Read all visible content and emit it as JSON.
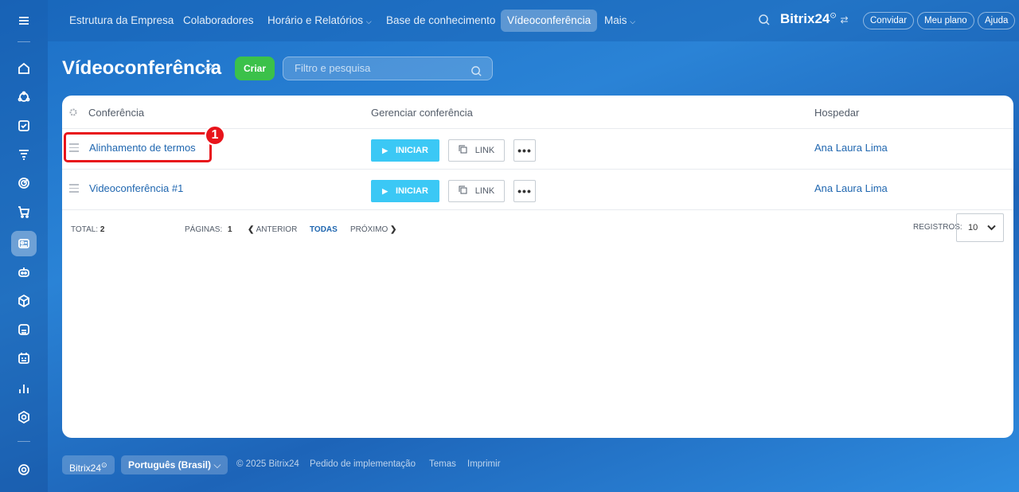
{
  "nav": {
    "items": [
      "Estrutura da Empresa",
      "Colaboradores",
      "Horário e Relatórios",
      "Base de conhecimento",
      "Vídeoconferência",
      "Mais"
    ],
    "brand": "Bitrix",
    "brand_num": "24",
    "invite": "Convidar",
    "plan": "Meu plano",
    "help": "Ajuda"
  },
  "page": {
    "title": "Vídeoconferência",
    "create": "Criar",
    "filter_placeholder": "Filtro e pesquisa"
  },
  "table": {
    "columns": [
      "Conferência",
      "Gerenciar conferência",
      "Hospedar"
    ],
    "rows": [
      {
        "name": "Alinhamento de termos",
        "start": "INICIAR",
        "link": "LINK",
        "more": "•••",
        "host": "Ana Laura Lima"
      },
      {
        "name": "Videoconferência #1",
        "start": "INICIAR",
        "link": "LINK",
        "more": "•••",
        "host": "Ana Laura Lima"
      }
    ],
    "total_label": "TOTAL:",
    "total": "2",
    "pages_label": "PÁGINAS:",
    "pages": "1",
    "prev": "ANTERIOR",
    "all": "TODAS",
    "next": "PRÓXIMO",
    "records_label": "REGISTROS:",
    "records": "10"
  },
  "annotation": {
    "badge": "1"
  },
  "footer": {
    "brand": "Bitrix24",
    "language": "Português (Brasil)",
    "copyright": "© 2025 Bitrix24",
    "implement": "Pedido de implementação",
    "themes": "Temas",
    "print": "Imprimir"
  },
  "colors": {
    "accent": "#3bc8f5",
    "create": "#3bc14a",
    "highlight": "#e8141b",
    "link": "#2067b0"
  }
}
